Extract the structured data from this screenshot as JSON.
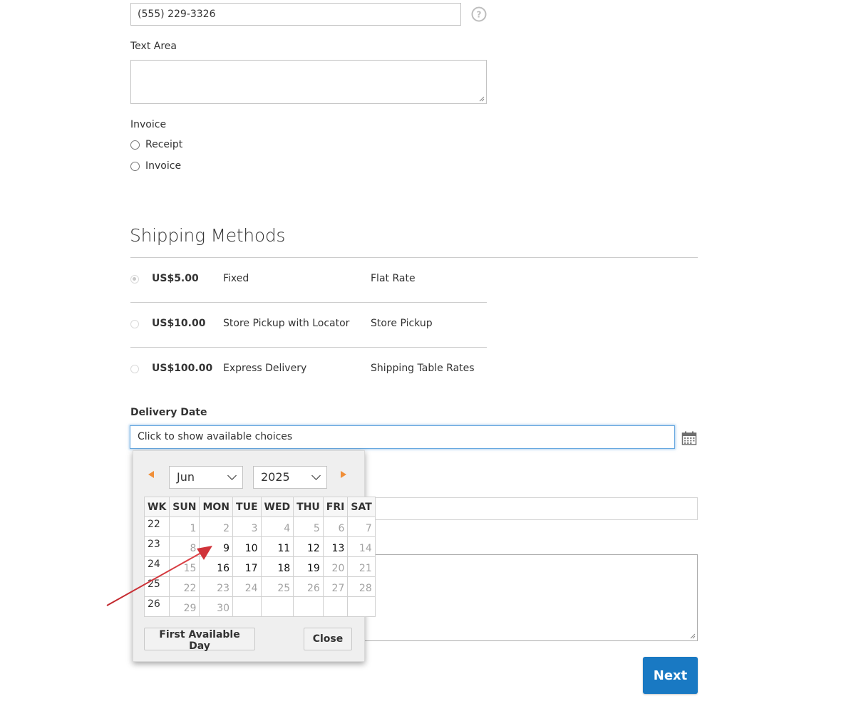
{
  "contact": {
    "phone_value": "(555) 229-3326"
  },
  "text_area": {
    "label": "Text Area",
    "value": ""
  },
  "invoice": {
    "label": "Invoice",
    "options": [
      "Receipt",
      "Invoice"
    ]
  },
  "shipping": {
    "title": "Shipping Methods",
    "methods": [
      {
        "price": "US$5.00",
        "method": "Fixed",
        "carrier": "Flat Rate",
        "selected": true
      },
      {
        "price": "US$10.00",
        "method": "Store Pickup with Locator",
        "carrier": "Store Pickup",
        "selected": false
      },
      {
        "price": "US$100.00",
        "method": "Express Delivery",
        "carrier": "Shipping Table Rates",
        "selected": false
      }
    ]
  },
  "delivery": {
    "label": "Delivery Date",
    "placeholder": "Click to show available choices"
  },
  "datepicker": {
    "month": "Jun",
    "year": "2025",
    "headers": [
      "WK",
      "SUN",
      "MON",
      "TUE",
      "WED",
      "THU",
      "FRI",
      "SAT"
    ],
    "weeks": [
      {
        "wk": "22",
        "days": [
          "1",
          "2",
          "3",
          "4",
          "5",
          "6",
          "7"
        ],
        "enabled": [
          false,
          false,
          false,
          false,
          false,
          false,
          false
        ]
      },
      {
        "wk": "23",
        "days": [
          "8",
          "9",
          "10",
          "11",
          "12",
          "13",
          "14"
        ],
        "enabled": [
          false,
          true,
          true,
          true,
          true,
          true,
          false
        ]
      },
      {
        "wk": "24",
        "days": [
          "15",
          "16",
          "17",
          "18",
          "19",
          "20",
          "21"
        ],
        "enabled": [
          false,
          true,
          true,
          true,
          true,
          false,
          false
        ]
      },
      {
        "wk": "25",
        "days": [
          "22",
          "23",
          "24",
          "25",
          "26",
          "27",
          "28"
        ],
        "enabled": [
          false,
          false,
          false,
          false,
          false,
          false,
          false
        ]
      },
      {
        "wk": "26",
        "days": [
          "29",
          "30",
          "",
          "",
          "",
          "",
          ""
        ],
        "enabled": [
          false,
          false,
          false,
          false,
          false,
          false,
          false
        ]
      }
    ],
    "first_available_label": "First Available Day",
    "close_label": "Close"
  },
  "actions": {
    "next_label": "Next"
  },
  "colors": {
    "primary_button": "#1979c3",
    "nav_arrow": "#f08f38",
    "annotation_arrow": "#d0333a",
    "focus_border": "#68a8e0"
  }
}
